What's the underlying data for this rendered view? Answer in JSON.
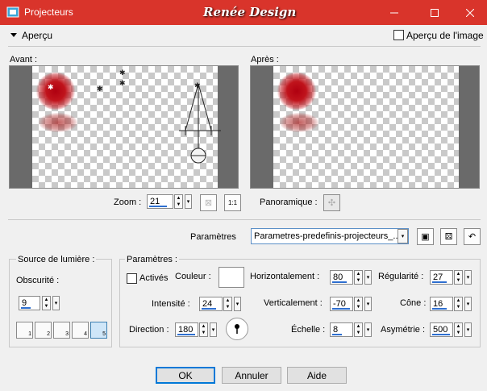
{
  "window": {
    "title": "Projecteurs",
    "brand": "Renée Design",
    "icons": {
      "app": "app-icon",
      "minimize": "minimize-icon",
      "maximize": "maximize-icon",
      "close": "close-icon"
    }
  },
  "preview_section": {
    "label": "Aperçu",
    "image_preview_checkbox": {
      "label": "Aperçu de l'image",
      "checked": false
    },
    "before_label": "Avant :",
    "after_label": "Après :",
    "zoom": {
      "label": "Zoom :",
      "value": "21"
    },
    "pan_label": "Panoramique :"
  },
  "presets": {
    "label": "Paramètres",
    "selected": "Parametres-predefinis-projecteurs_..."
  },
  "light_source": {
    "title": "Source de lumière :",
    "obscurity_label": "Obscurité :",
    "obscurity_value": "9",
    "light_buttons": [
      "1",
      "2",
      "3",
      "4",
      "5"
    ],
    "active_light": "5"
  },
  "parameters": {
    "title": "Paramètres :",
    "active_checkbox": {
      "label": "Activés",
      "checked": false
    },
    "color_label": "Couleur :",
    "color_value": "#ffffff",
    "intensity_label": "Intensité :",
    "intensity_value": "24",
    "direction_label": "Direction :",
    "direction_value": "180",
    "horizontal_label": "Horizontalement :",
    "horizontal_value": "80",
    "vertical_label": "Verticalement :",
    "vertical_value": "-70",
    "scale_label": "Échelle :",
    "scale_value": "8",
    "regularity_label": "Régularité :",
    "regularity_value": "27",
    "cone_label": "Cône :",
    "cone_value": "16",
    "asymmetry_label": "Asymétrie :",
    "asymmetry_value": "500"
  },
  "buttons": {
    "ok": "OK",
    "cancel": "Annuler",
    "help": "Aide"
  },
  "colors": {
    "titlebar": "#d9342b",
    "accent": "#2e6fd0",
    "spot": "#c0141c"
  }
}
